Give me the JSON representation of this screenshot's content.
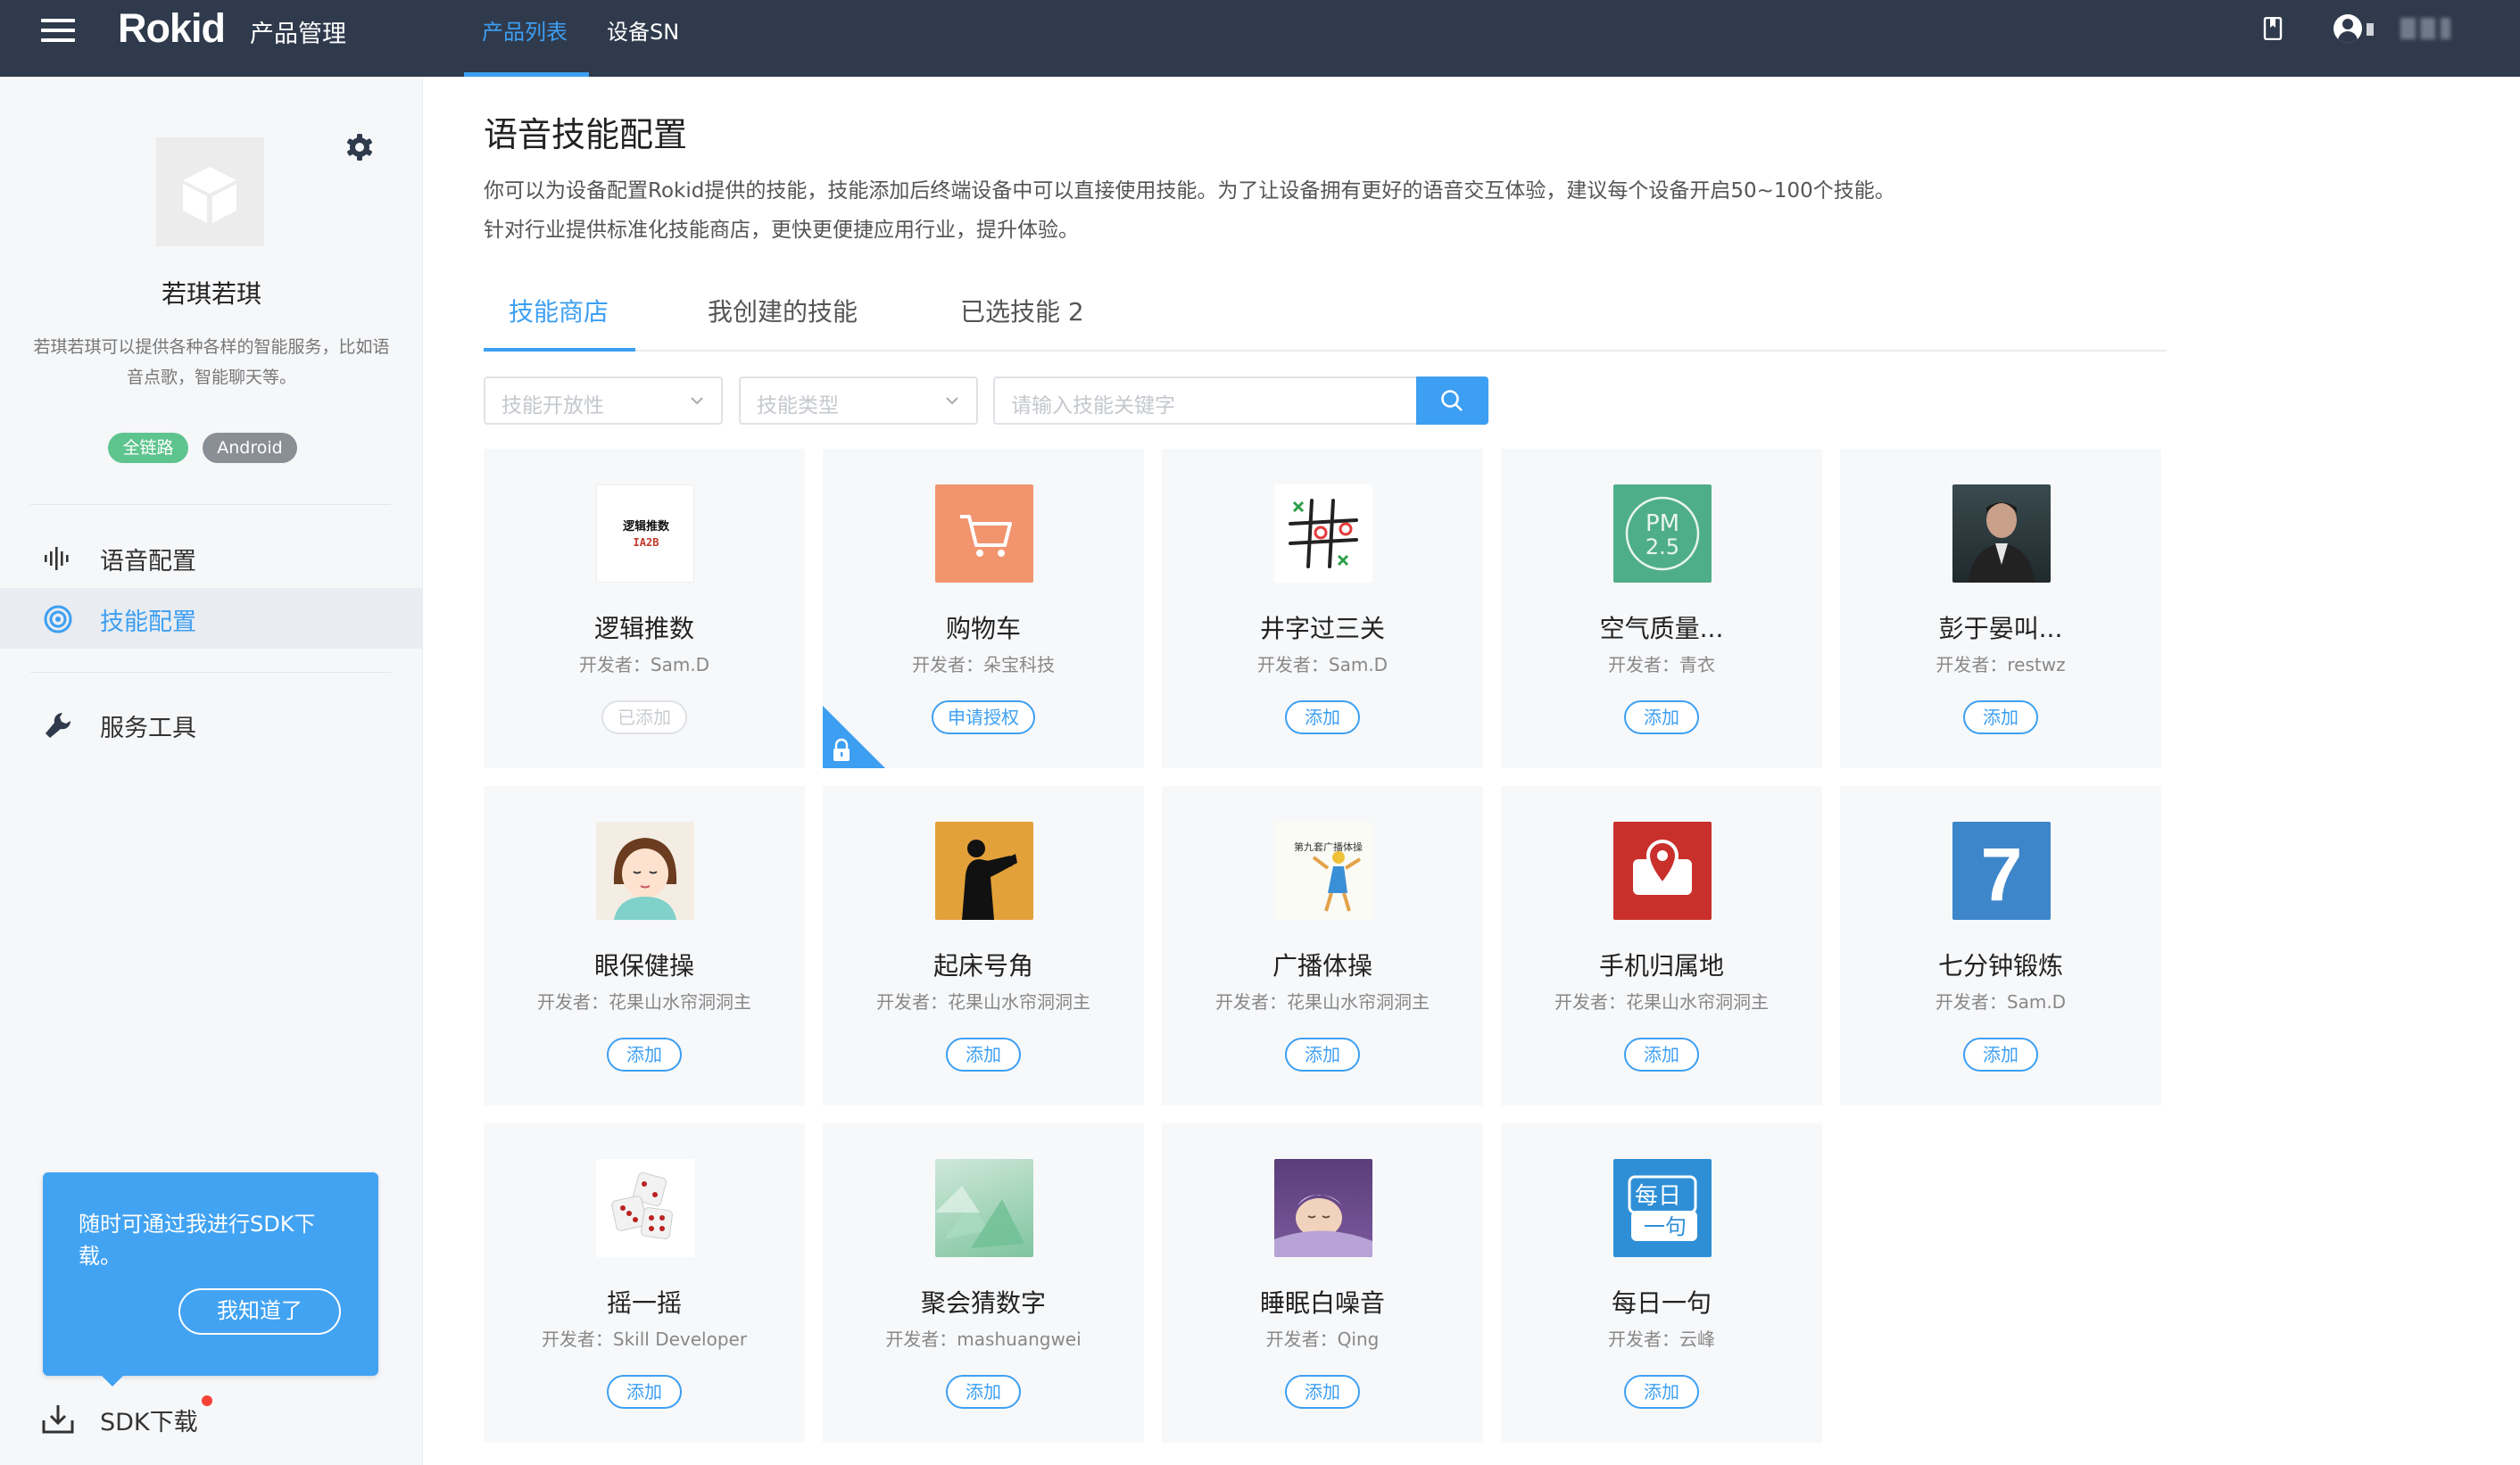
{
  "topbar": {
    "brand": "Rokid",
    "product_title": "产品管理",
    "nav": [
      "产品列表",
      "设备SN"
    ]
  },
  "sidebar": {
    "product_name": "若琪若琪",
    "product_desc": "若琪若琪可以提供各种各样的智能服务，比如语音点歌，智能聊天等。",
    "tags": [
      "全链路",
      "Android"
    ],
    "menu": [
      {
        "label": "语音配置",
        "icon": "waveform-icon"
      },
      {
        "label": "技能配置",
        "icon": "target-icon"
      },
      {
        "label": "服务工具",
        "icon": "wrench-icon"
      }
    ],
    "tip": {
      "text": "随时可通过我进行SDK下载。",
      "button": "我知道了"
    },
    "sdk_label": "SDK下载"
  },
  "main": {
    "title": "语音技能配置",
    "desc_lines": [
      "你可以为设备配置Rokid提供的技能，技能添加后终端设备中可以直接使用技能。为了让设备拥有更好的语音交互体验，建议每个设备开启50~100个技能。",
      "针对行业提供标准化技能商店，更快更便捷应用行业，提升体验。"
    ],
    "tabs": [
      "技能商店",
      "我创建的技能",
      "已选技能 2"
    ],
    "filters": {
      "openness_placeholder": "技能开放性",
      "type_placeholder": "技能类型",
      "search_placeholder": "请输入技能关键字"
    },
    "skills": [
      {
        "name": "逻辑推数",
        "dev": "开发者：Sam.D",
        "btn": "已添加"
      },
      {
        "name": "购物车",
        "dev": "开发者：朵宝科技",
        "btn": "申请授权"
      },
      {
        "name": "井字过三关",
        "dev": "开发者：Sam.D",
        "btn": "添加"
      },
      {
        "name": "空气质量...",
        "dev": "开发者：青衣",
        "btn": "添加"
      },
      {
        "name": "彭于晏叫...",
        "dev": "开发者：restwz",
        "btn": "添加"
      },
      {
        "name": "眼保健操",
        "dev": "开发者：花果山水帘洞洞主",
        "btn": "添加"
      },
      {
        "name": "起床号角",
        "dev": "开发者：花果山水帘洞洞主",
        "btn": "添加"
      },
      {
        "name": "广播体操",
        "dev": "开发者：花果山水帘洞洞主",
        "btn": "添加"
      },
      {
        "name": "手机归属地",
        "dev": "开发者：花果山水帘洞洞主",
        "btn": "添加"
      },
      {
        "name": "七分钟锻炼",
        "dev": "开发者：Sam.D",
        "btn": "添加"
      },
      {
        "name": "摇一摇",
        "dev": "开发者：Skill Developer",
        "btn": "添加"
      },
      {
        "name": "聚会猜数字",
        "dev": "开发者：mashuangwei",
        "btn": "添加"
      },
      {
        "name": "睡眠白噪音",
        "dev": "开发者：Qing",
        "btn": "添加"
      },
      {
        "name": "每日一句",
        "dev": "开发者：云峰",
        "btn": "添加"
      }
    ],
    "icon_text": {
      "logic_top": "逻辑推数",
      "logic_bottom": "IA2B",
      "pm_top": "PM",
      "pm_bottom": "2.5",
      "seven": "7",
      "broadcast": "第九套广播体操",
      "daily_top": "每日",
      "daily_bottom": "一句"
    }
  },
  "colors": {
    "topbar_bg": "#2f3a4c",
    "accent": "#3d9ff2",
    "tag_green": "#5ec48e",
    "tag_gray": "#8a8f96"
  }
}
